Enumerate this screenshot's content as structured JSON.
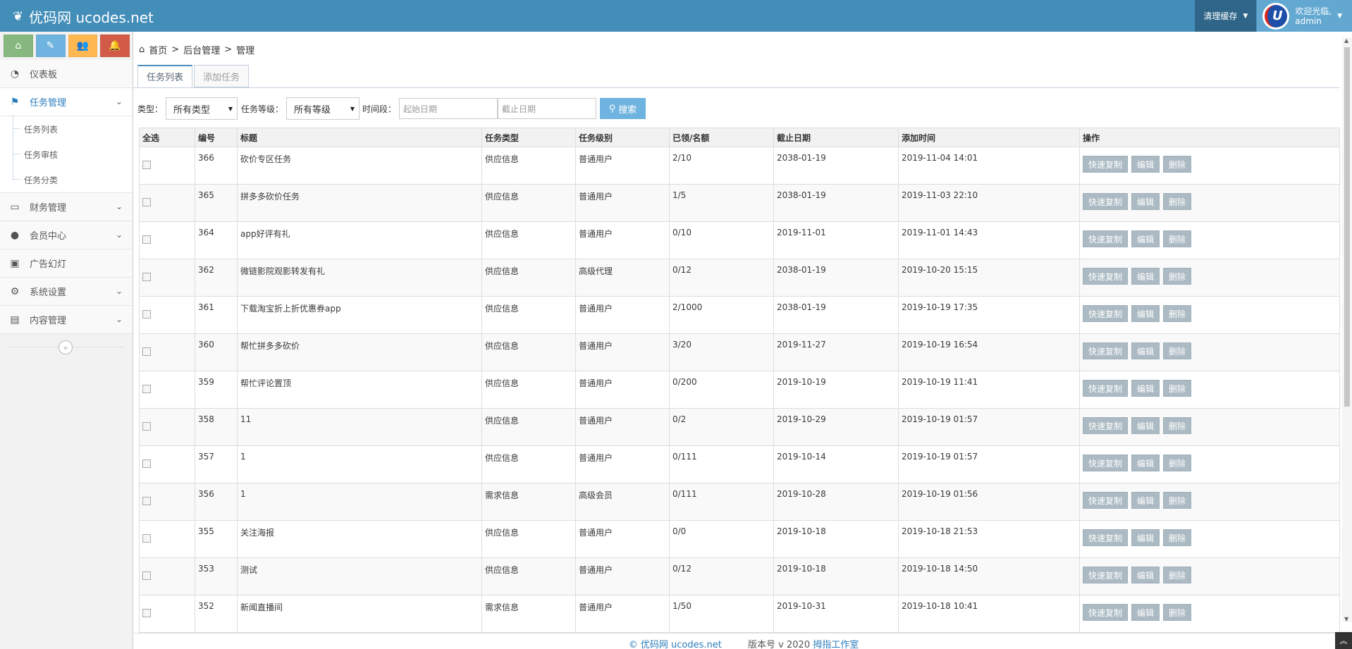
{
  "header": {
    "brand": "优码网 ucodes.net",
    "clear_cache": "清理缓存",
    "welcome": "欢迎光临,",
    "username": "admin",
    "avatar_letter": "U"
  },
  "sidebar": {
    "shortcuts": [
      "home-icon",
      "pencil-icon",
      "users-icon",
      "bell-icon"
    ],
    "items": [
      {
        "label": "仪表板",
        "icon": "dashboard-icon"
      },
      {
        "label": "任务管理",
        "icon": "flag-icon"
      },
      {
        "label": "财务管理",
        "icon": "inbox-icon"
      },
      {
        "label": "会员中心",
        "icon": "user-icon"
      },
      {
        "label": "广告幻灯",
        "icon": "image-icon"
      },
      {
        "label": "系统设置",
        "icon": "gear-icon"
      },
      {
        "label": "内容管理",
        "icon": "book-icon"
      }
    ],
    "sub_items": [
      "任务列表",
      "任务审核",
      "任务分类"
    ]
  },
  "breadcrumb": {
    "home": "首页",
    "sep1": ">",
    "level2": "后台管理",
    "sep2": ">",
    "level3": "管理"
  },
  "tabs": [
    "任务列表",
    "添加任务"
  ],
  "filter": {
    "type_label": "类型：",
    "type_value": "所有类型",
    "level_label": "任务等级：",
    "level_value": "所有等级",
    "period_label": "时间段：",
    "start_placeholder": "起始日期",
    "end_placeholder": "截止日期",
    "search_button": "搜索"
  },
  "table": {
    "headers": [
      "全选",
      "编号",
      "标题",
      "任务类型",
      "任务级别",
      "已领/名额",
      "截止日期",
      "添加时间",
      "操作"
    ],
    "rows": [
      {
        "id": "366",
        "title": "砍价专区任务",
        "type": "供应信息",
        "level": "普通用户",
        "quota": "2/10",
        "deadline": "2038-01-19",
        "added": "2019-11-04 14:01"
      },
      {
        "id": "365",
        "title": "拼多多砍价任务",
        "type": "供应信息",
        "level": "普通用户",
        "quota": "1/5",
        "deadline": "2038-01-19",
        "added": "2019-11-03 22:10"
      },
      {
        "id": "364",
        "title": "app好评有礼",
        "type": "供应信息",
        "level": "普通用户",
        "quota": "0/10",
        "deadline": "2019-11-01",
        "added": "2019-11-01 14:43"
      },
      {
        "id": "362",
        "title": "微链影院观影转发有礼",
        "type": "供应信息",
        "level": "高级代理",
        "quota": "0/12",
        "deadline": "2038-01-19",
        "added": "2019-10-20 15:15"
      },
      {
        "id": "361",
        "title": "下载淘宝折上折优惠券app",
        "type": "供应信息",
        "level": "普通用户",
        "quota": "2/1000",
        "deadline": "2038-01-19",
        "added": "2019-10-19 17:35"
      },
      {
        "id": "360",
        "title": "帮忙拼多多砍价",
        "type": "供应信息",
        "level": "普通用户",
        "quota": "3/20",
        "deadline": "2019-11-27",
        "added": "2019-10-19 16:54"
      },
      {
        "id": "359",
        "title": "帮忙评论置顶",
        "type": "供应信息",
        "level": "普通用户",
        "quota": "0/200",
        "deadline": "2019-10-19",
        "added": "2019-10-19 11:41"
      },
      {
        "id": "358",
        "title": "11",
        "type": "供应信息",
        "level": "普通用户",
        "quota": "0/2",
        "deadline": "2019-10-29",
        "added": "2019-10-19 01:57"
      },
      {
        "id": "357",
        "title": "1",
        "type": "供应信息",
        "level": "普通用户",
        "quota": "0/111",
        "deadline": "2019-10-14",
        "added": "2019-10-19 01:57"
      },
      {
        "id": "356",
        "title": "1",
        "type": "需求信息",
        "level": "高级会员",
        "quota": "0/111",
        "deadline": "2019-10-28",
        "added": "2019-10-19 01:56"
      },
      {
        "id": "355",
        "title": "关注海报",
        "type": "供应信息",
        "level": "普通用户",
        "quota": "0/0",
        "deadline": "2019-10-18",
        "added": "2019-10-18 21:53"
      },
      {
        "id": "353",
        "title": "测试",
        "type": "供应信息",
        "level": "普通用户",
        "quota": "0/12",
        "deadline": "2019-10-18",
        "added": "2019-10-18 14:50"
      },
      {
        "id": "352",
        "title": "新闻直播间",
        "type": "需求信息",
        "level": "普通用户",
        "quota": "1/50",
        "deadline": "2019-10-31",
        "added": "2019-10-18 10:41"
      }
    ],
    "actions": [
      "快速复制",
      "编辑",
      "删除"
    ]
  },
  "footer": {
    "copyright": "© 优码网 ucodes.net",
    "version": "版本号 v 2020",
    "studio": "拇指工作室"
  },
  "colors": {
    "navbar": "#438eb9",
    "accent": "#6fb3e0",
    "action_button": "#abbac3"
  }
}
